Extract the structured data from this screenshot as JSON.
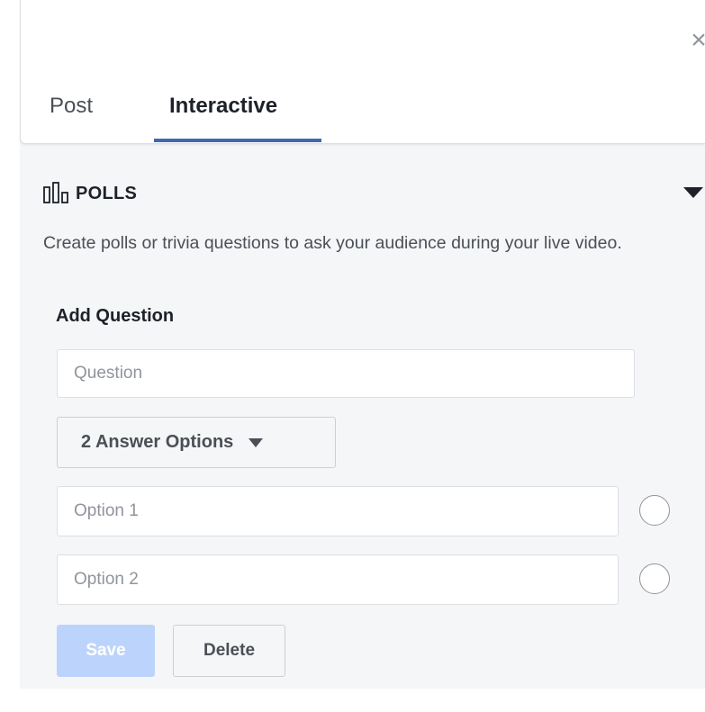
{
  "header": {
    "close_glyph": "×",
    "tabs": [
      {
        "label": "Post",
        "active": false
      },
      {
        "label": "Interactive",
        "active": true
      }
    ],
    "accent_color": "#4267b2"
  },
  "polls": {
    "icon": "poll-bars-icon",
    "title": "POLLS",
    "collapse_icon": "caret-down-icon",
    "description": "Create polls or trivia questions to ask your audience during your live video.",
    "add_question_label": "Add Question",
    "question_placeholder": "Question",
    "answer_options_label": "2 Answer Options",
    "options": [
      {
        "placeholder": "Option 1"
      },
      {
        "placeholder": "Option 2"
      }
    ],
    "save_label": "Save",
    "delete_label": "Delete",
    "save_color": "#bcd4fb"
  }
}
